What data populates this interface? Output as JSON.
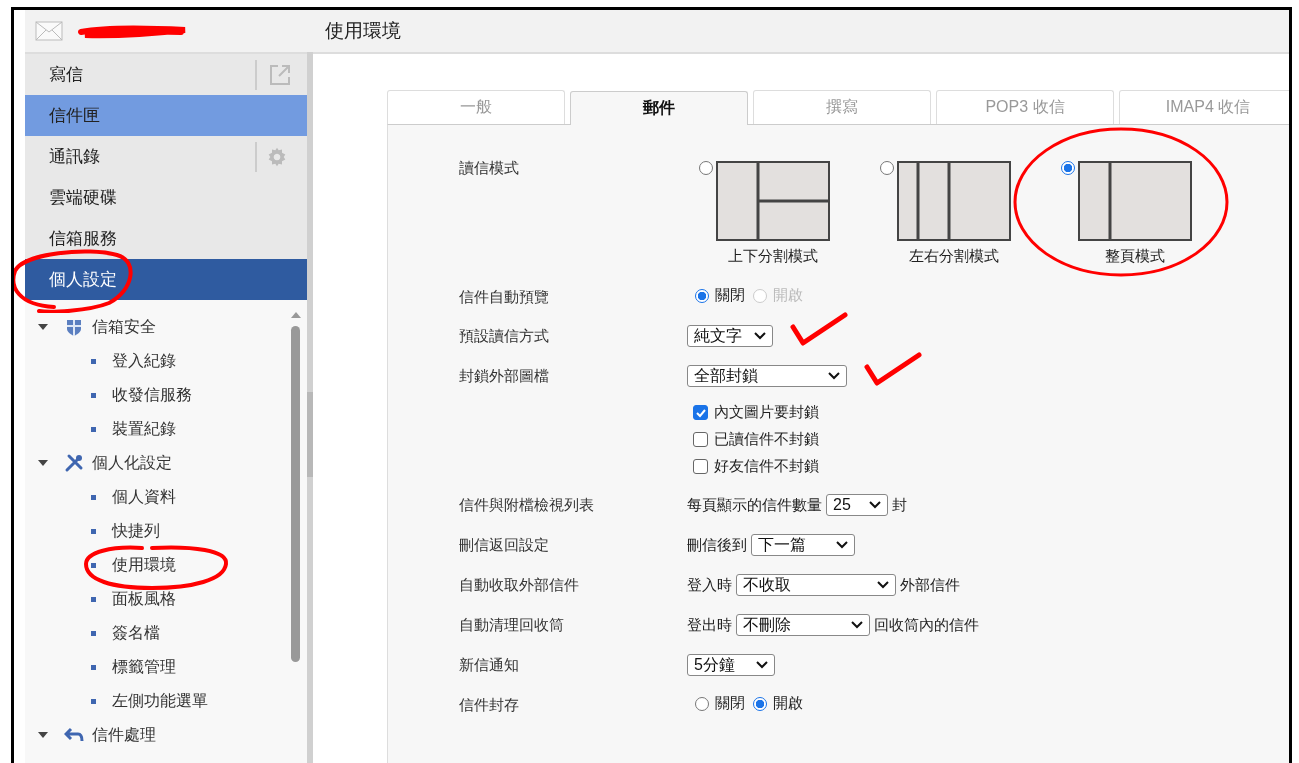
{
  "header": {
    "account_redacted": true,
    "title": "使用環境"
  },
  "nav": [
    {
      "label": "寫信",
      "kind": "popout",
      "selected": false,
      "hovered": false,
      "circled": false
    },
    {
      "label": "信件匣",
      "kind": "plain",
      "selected": false,
      "hovered": true,
      "circled": false
    },
    {
      "label": "通訊錄",
      "kind": "settings",
      "selected": false,
      "hovered": false,
      "circled": false
    },
    {
      "label": "雲端硬碟",
      "kind": "plain",
      "selected": false,
      "hovered": false,
      "circled": false
    },
    {
      "label": "信箱服務",
      "kind": "plain",
      "selected": false,
      "hovered": false,
      "circled": false
    },
    {
      "label": "個人設定",
      "kind": "plain",
      "selected": true,
      "hovered": false,
      "circled": true
    }
  ],
  "tree": [
    {
      "label": "信箱安全",
      "kind": "shield",
      "expanded": true,
      "children": [
        {
          "label": "登入紀錄",
          "circled": false
        },
        {
          "label": "收發信服務",
          "circled": false
        },
        {
          "label": "裝置紀錄",
          "circled": false
        }
      ]
    },
    {
      "label": "個人化設定",
      "kind": "tools",
      "expanded": true,
      "children": [
        {
          "label": "個人資料",
          "circled": false
        },
        {
          "label": "快捷列",
          "circled": false
        },
        {
          "label": "使用環境",
          "circled": true
        },
        {
          "label": "面板風格",
          "circled": false
        },
        {
          "label": "簽名檔",
          "circled": false
        },
        {
          "label": "標籤管理",
          "circled": false
        },
        {
          "label": "左側功能選單",
          "circled": false
        }
      ]
    },
    {
      "label": "信件處理",
      "kind": "return",
      "expanded": true
    }
  ],
  "tabs": [
    {
      "label": "一般",
      "selected": false
    },
    {
      "label": "郵件",
      "selected": true
    },
    {
      "label": "撰寫",
      "selected": false
    },
    {
      "label": "POP3 收信",
      "selected": false
    },
    {
      "label": "IMAP4 收信",
      "selected": false
    }
  ],
  "settings": [
    {
      "kind": "layout",
      "label": "讀信模式",
      "options": [
        {
          "kind": "top-bottom",
          "label": "上下分割模式",
          "selected": false,
          "circled": false
        },
        {
          "kind": "left-right",
          "label": "左右分割模式",
          "selected": false,
          "circled": false
        },
        {
          "kind": "full",
          "label": "整頁模式",
          "selected": true,
          "circled": true
        }
      ]
    },
    {
      "kind": "radio",
      "label": "信件自動預覽",
      "options": [
        {
          "label": "關閉",
          "selected": true,
          "disabled": false
        },
        {
          "label": "開啟",
          "selected": false,
          "disabled": true
        }
      ]
    },
    {
      "kind": "select",
      "label": "預設讀信方式",
      "select": {
        "value": "純文字",
        "ticked": true
      }
    },
    {
      "kind": "select",
      "label": "封鎖外部圖檔",
      "select": {
        "value": "全部封鎖",
        "ticked": true
      },
      "checks": [
        {
          "label": "內文圖片要封鎖",
          "checked": true
        },
        {
          "label": "已讀信件不封鎖",
          "checked": false
        },
        {
          "label": "好友信件不封鎖",
          "checked": false
        }
      ]
    },
    {
      "kind": "select",
      "label": "信件與附檔檢視列表",
      "prefix": "每頁顯示的信件數量",
      "select": {
        "value": "25",
        "ticked": false
      },
      "suffix": "封"
    },
    {
      "kind": "select",
      "label": "刪信返回設定",
      "prefix": "刪信後到",
      "select": {
        "value": "下一篇",
        "ticked": false
      }
    },
    {
      "kind": "select",
      "label": "自動收取外部信件",
      "prefix": "登入時",
      "select": {
        "value": "不收取",
        "ticked": false
      },
      "suffix": "外部信件"
    },
    {
      "kind": "select",
      "label": "自動清理回收筒",
      "prefix": "登出時",
      "select": {
        "value": "不刪除",
        "ticked": false
      },
      "suffix": "回收筒內的信件"
    },
    {
      "kind": "select",
      "label": "新信通知",
      "select": {
        "value": "5分鐘",
        "ticked": false
      }
    },
    {
      "kind": "radio",
      "label": "信件封存",
      "options": [
        {
          "label": "關閉",
          "selected": false,
          "disabled": false
        },
        {
          "label": "開啟",
          "selected": true,
          "disabled": false
        }
      ]
    }
  ]
}
